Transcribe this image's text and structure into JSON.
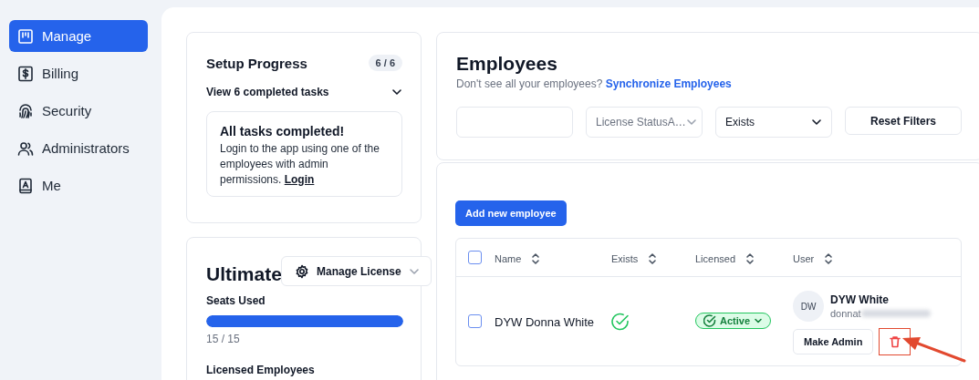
{
  "sidebar": {
    "items": [
      {
        "label": "Manage",
        "selected": true
      },
      {
        "label": "Billing",
        "selected": false
      },
      {
        "label": "Security",
        "selected": false
      },
      {
        "label": "Administrators",
        "selected": false
      },
      {
        "label": "Me",
        "selected": false
      }
    ]
  },
  "setup": {
    "title": "Setup Progress",
    "badge": "6 / 6",
    "toggle": "View 6 completed tasks",
    "notice": {
      "title": "All tasks completed!",
      "text": "Login to the app using one of the employees with admin permissions.",
      "link": "Login"
    }
  },
  "license": {
    "title": "Ultimate",
    "menu": "Manage License",
    "seats_label": "Seats Used",
    "level": 1,
    "reading": "15 / 15",
    "next_label": "Licensed Employees"
  },
  "employees": {
    "title": "Employees",
    "subtitle": "Don't see all your employees?",
    "link": "Synchronize Employees",
    "filters": {
      "license_status": {
        "placeholder": "License StatusA…"
      },
      "exists": {
        "value": "Exists"
      },
      "reset": "Reset Filters"
    },
    "add_button": "Add new employee",
    "table": {
      "select_all": {
        "checked": false
      },
      "columns": [
        "Name",
        "Exists",
        "Licensed",
        "User"
      ],
      "rows": [
        {
          "checked": false,
          "name": "DYW Donna White",
          "exists": true,
          "licensed": "Active",
          "user": {
            "initials": "DW",
            "name": "DYW White",
            "email": "donnat",
            "email_blurred": true
          },
          "make_admin": "Make Admin",
          "delete_highlighted": true
        }
      ]
    }
  }
}
